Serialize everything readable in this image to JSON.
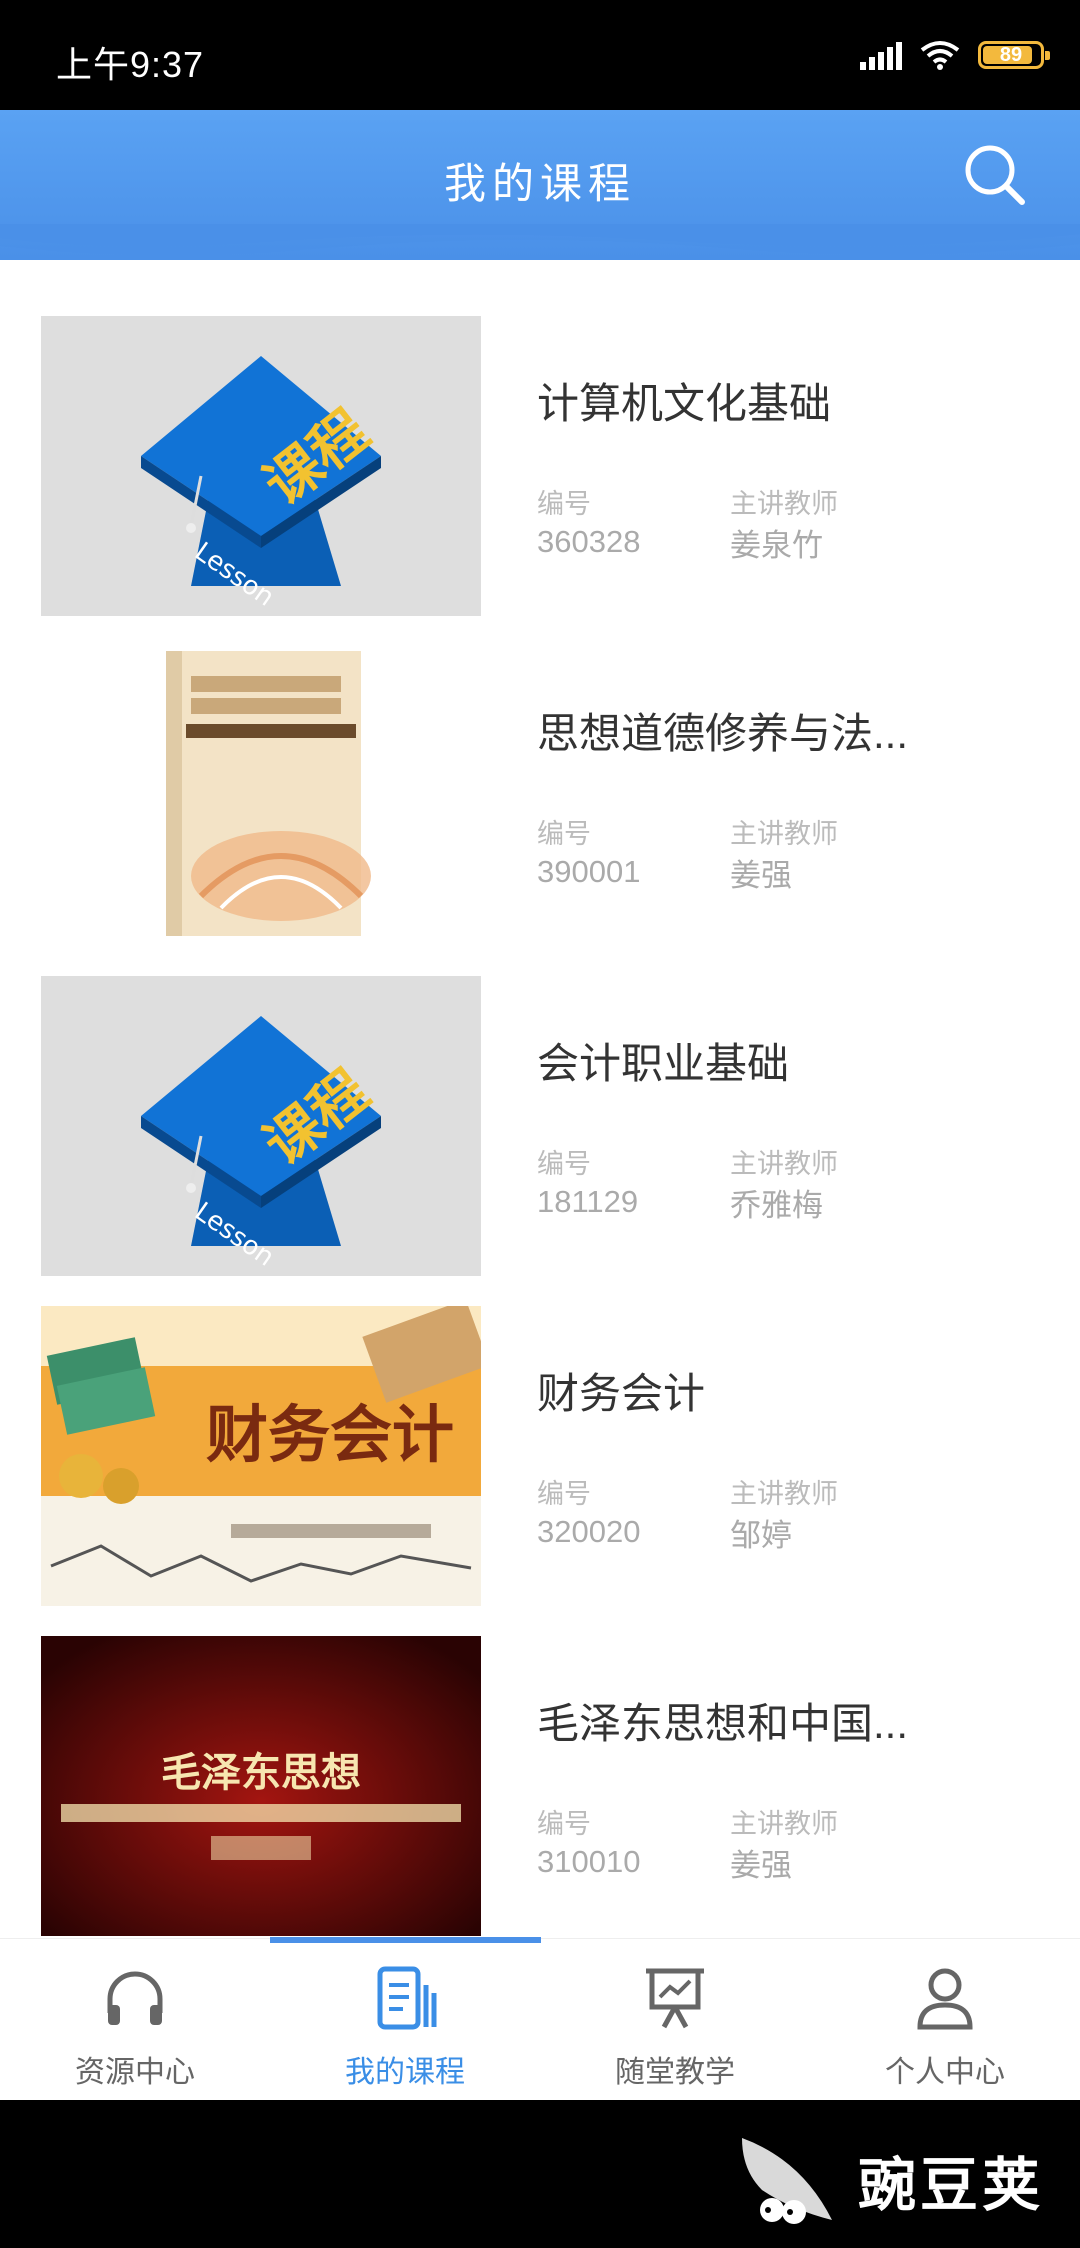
{
  "status_bar": {
    "time": "上午9:37",
    "battery": "89",
    "battery_level": 0.89
  },
  "header": {
    "title": "我的课程"
  },
  "courses": [
    {
      "title": "计算机文化基础",
      "code_label": "编号",
      "code": "360328",
      "teacher_label": "主讲教师",
      "teacher": "姜泉竹",
      "thumb": "lesson-cap",
      "thumb_text": "课程"
    },
    {
      "title": "思想道德修养与法...",
      "code_label": "编号",
      "code": "390001",
      "teacher_label": "主讲教师",
      "teacher": "姜强",
      "thumb": "book-cover"
    },
    {
      "title": "会计职业基础",
      "code_label": "编号",
      "code": "181129",
      "teacher_label": "主讲教师",
      "teacher": "乔雅梅",
      "thumb": "lesson-cap",
      "thumb_text": "课程"
    },
    {
      "title": "财务会计",
      "code_label": "编号",
      "code": "320020",
      "teacher_label": "主讲教师",
      "teacher": "邹婷",
      "thumb": "finance-banner",
      "thumb_text": "财务会计"
    },
    {
      "title": "毛泽东思想和中国...",
      "code_label": "编号",
      "code": "310010",
      "teacher_label": "主讲教师",
      "teacher": "姜强",
      "thumb": "red-banner",
      "thumb_text": "毛泽东思想"
    }
  ],
  "tabs": [
    {
      "label": "资源中心",
      "icon": "headphones-icon",
      "active": false
    },
    {
      "label": "我的课程",
      "icon": "document-icon",
      "active": true
    },
    {
      "label": "随堂教学",
      "icon": "presentation-icon",
      "active": false
    },
    {
      "label": "个人中心",
      "icon": "person-icon",
      "active": false
    }
  ],
  "watermark": {
    "text": "豌豆荚"
  },
  "colors": {
    "accent": "#4a90e8",
    "header_top": "#5aa2f3",
    "active_tab": "#3a8ee6",
    "battery": "#f3b93d"
  }
}
